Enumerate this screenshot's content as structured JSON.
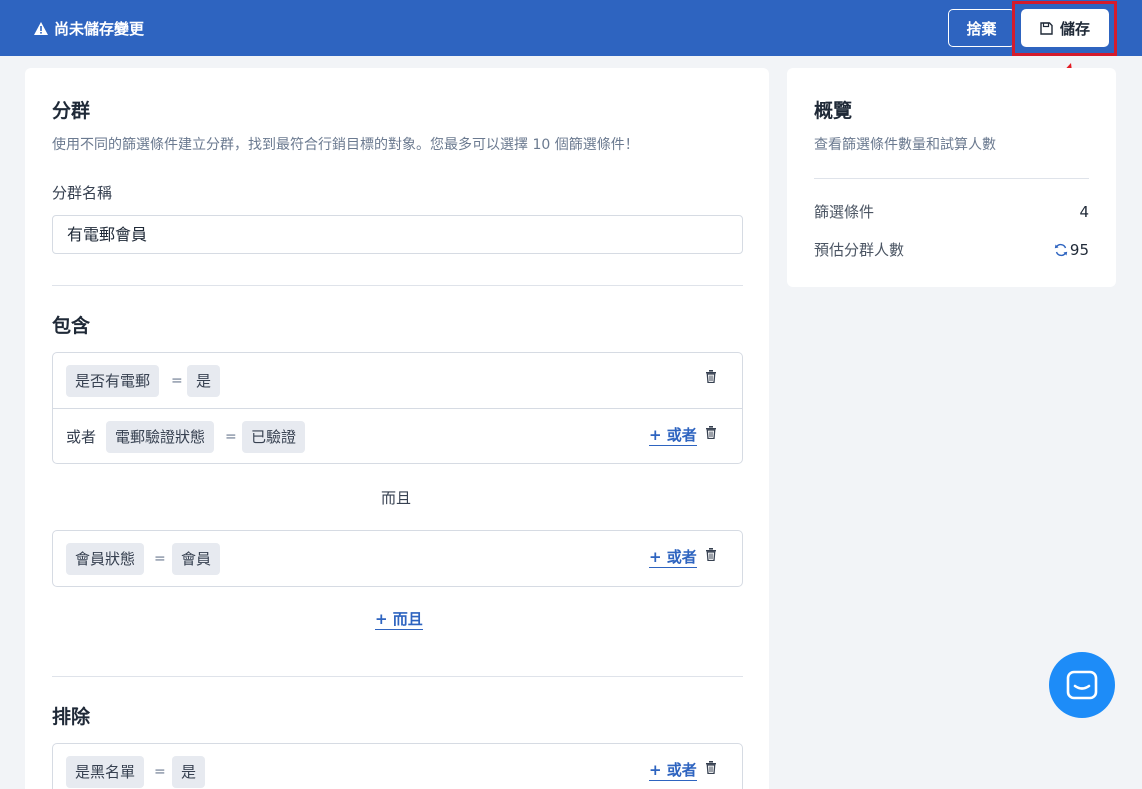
{
  "topbar": {
    "warning_text": "尚未儲存變更",
    "discard_label": "捨棄",
    "save_label": "儲存"
  },
  "segment": {
    "title": "分群",
    "description": "使用不同的篩選條件建立分群，找到最符合行銷目標的對象。您最多可以選擇 10 個篩選條件！",
    "name_label": "分群名稱",
    "name_value": "有電郵會員"
  },
  "include": {
    "title": "包含",
    "groups": [
      {
        "rows": [
          {
            "field": "是否有電郵",
            "op": "=",
            "value": "是"
          },
          {
            "prefix": "或者",
            "field": "電郵驗證狀態",
            "op": "=",
            "value": "已驗證",
            "add_or": "+ 或者"
          }
        ]
      },
      {
        "rows": [
          {
            "field": "會員狀態",
            "op": "=",
            "value": "會員",
            "add_or": "+ 或者"
          }
        ]
      }
    ],
    "and_separator": "而且",
    "add_and": "+ 而且"
  },
  "exclude": {
    "title": "排除",
    "rows": [
      {
        "field": "是黑名單",
        "op": "=",
        "value": "是",
        "add_or": "+ 或者"
      }
    ]
  },
  "overview": {
    "title": "概覽",
    "description": "查看篩選條件數量和試算人數",
    "filter_count_label": "篩選條件",
    "filter_count_value": "4",
    "estimate_label": "預估分群人數",
    "estimate_value": "95"
  },
  "colors": {
    "brand": "#2e64c0",
    "highlight": "#d41b2c",
    "chat": "#1d8cf8"
  }
}
